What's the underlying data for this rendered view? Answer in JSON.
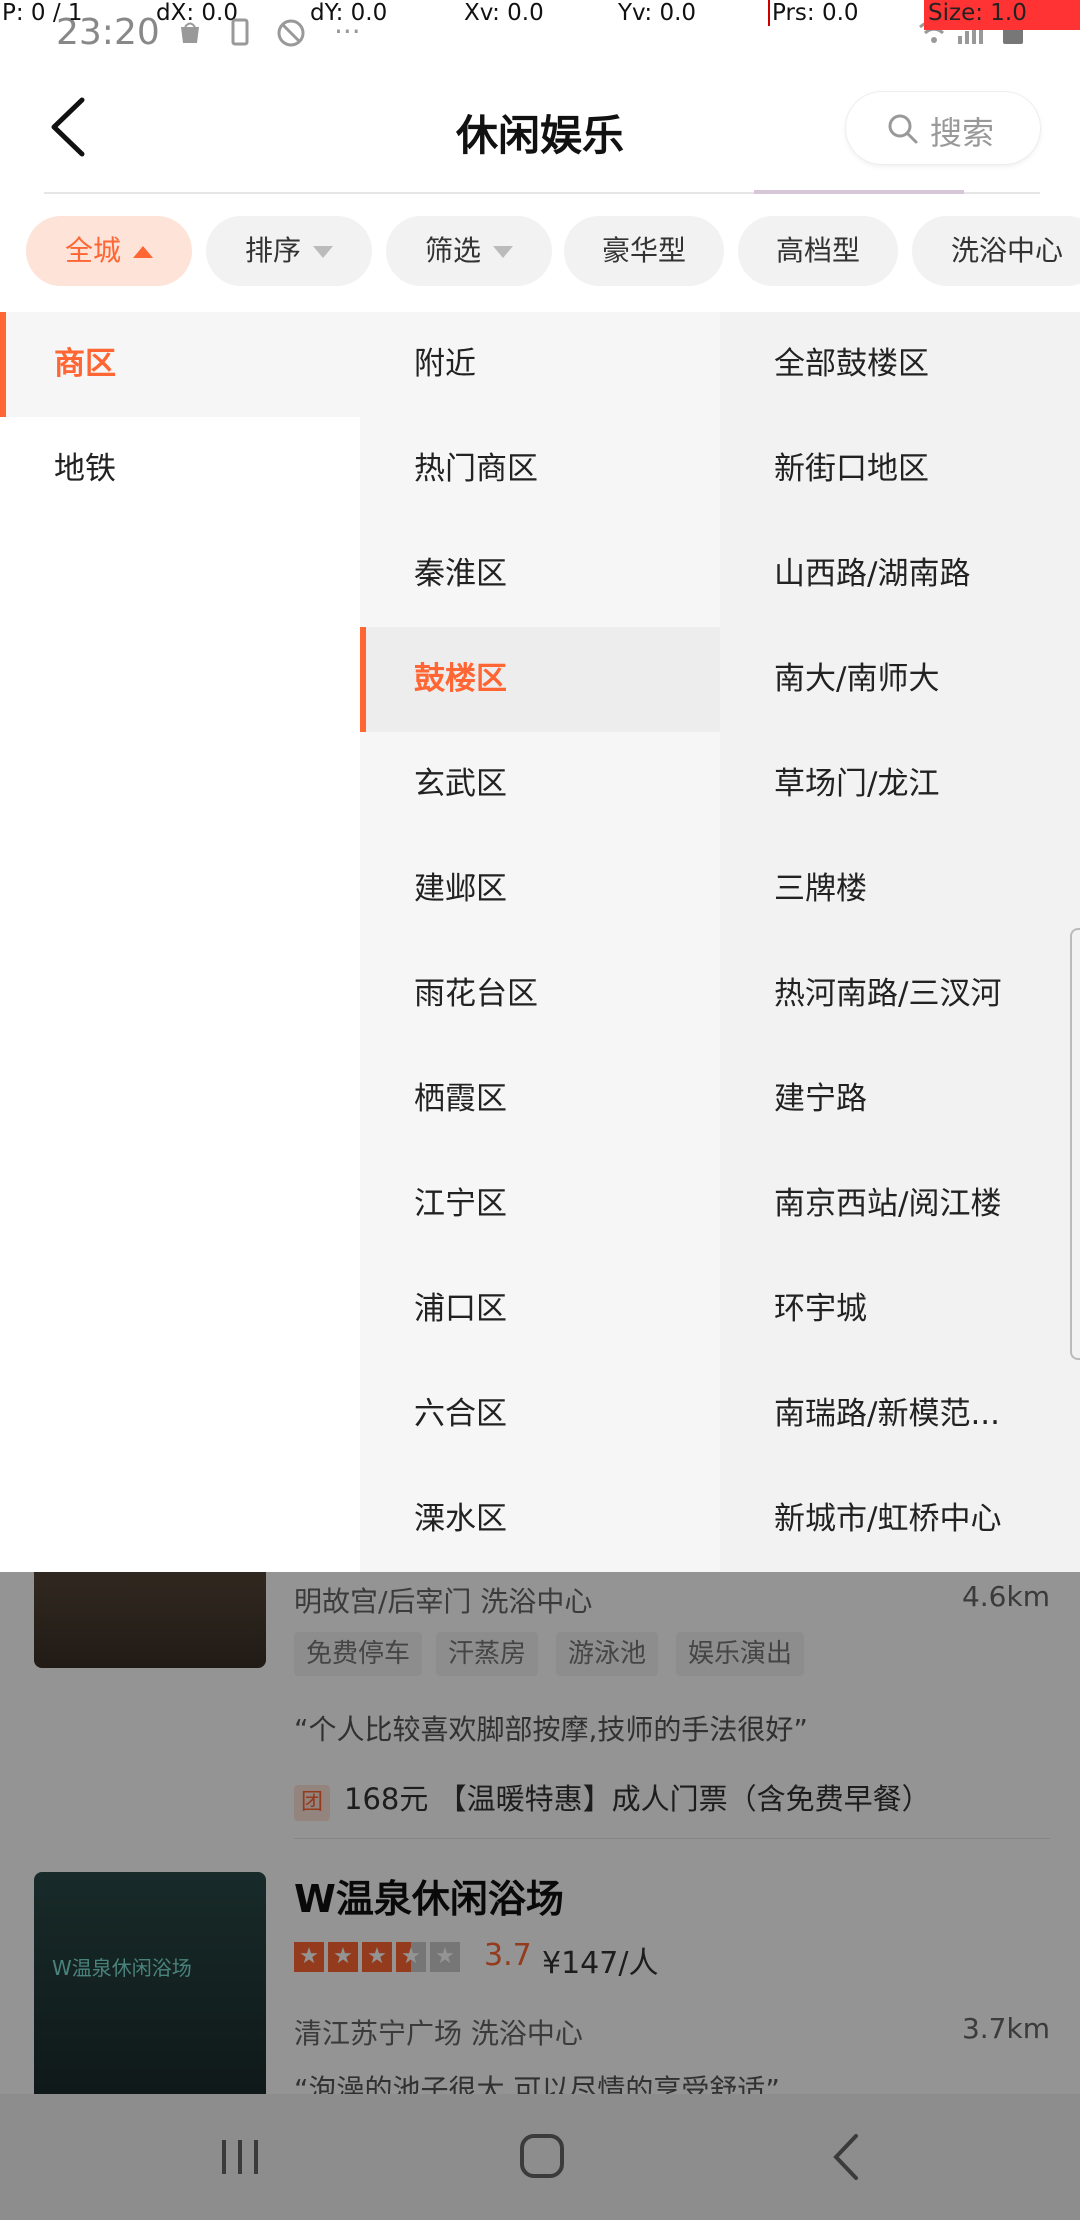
{
  "debug": {
    "p": "P: 0 / 1",
    "dx": "dX: 0.0",
    "dy": "dY: 0.0",
    "xv": "Xv: 0.0",
    "yv": "Yv: 0.0",
    "prs": "Prs: 0.0",
    "size": "Size: 1.0"
  },
  "status": {
    "time": "23:20",
    "overflow": "···"
  },
  "header": {
    "title": "休闲娱乐",
    "search_label": "搜索"
  },
  "filters": [
    {
      "label": "全城",
      "state": "open"
    },
    {
      "label": "排序",
      "state": "closed"
    },
    {
      "label": "筛选",
      "state": "closed"
    },
    {
      "label": "豪华型"
    },
    {
      "label": "高档型"
    },
    {
      "label": "洗浴中心"
    }
  ],
  "panel": {
    "col1": [
      "商区",
      "地铁"
    ],
    "col1_active": 0,
    "col2": [
      "附近",
      "热门商区",
      "秦淮区",
      "鼓楼区",
      "玄武区",
      "建邺区",
      "雨花台区",
      "栖霞区",
      "江宁区",
      "浦口区",
      "六合区",
      "溧水区"
    ],
    "col2_active": 3,
    "col3": [
      "全部鼓楼区",
      "新街口地区",
      "山西路/湖南路",
      "南大/南师大",
      "草场门/龙江",
      "三牌楼",
      "热河南路/三汊河",
      "建宁路",
      "南京西站/阅江楼",
      "环宇城",
      "南瑞路/新模范...",
      "新城市/虹桥中心"
    ]
  },
  "listing1": {
    "meta": "明故宫/后宰门  洗浴中心",
    "distance": "4.6km",
    "tags": [
      "免费停车",
      "汗蒸房",
      "游泳池",
      "娱乐演出"
    ],
    "review": "“个人比较喜欢脚部按摩,技师的手法很好”",
    "deal_badge": "团",
    "deal": "168元 【温暖特惠】成人门票（含免费早餐）"
  },
  "listing2": {
    "name": "W温泉休闲浴场",
    "rating": 3.7,
    "score": "3.7",
    "price": "¥147/人",
    "meta": "清江苏宁广场  洗浴中心",
    "distance": "3.7km",
    "review": "“泡澡的池子很大,可以尽情的享受舒适”",
    "thumb_text": "W温泉休闲浴场"
  },
  "colors": {
    "accent": "#ff6633",
    "panel_mid": "#f6f6f6",
    "panel_right": "#f2f2f2"
  }
}
